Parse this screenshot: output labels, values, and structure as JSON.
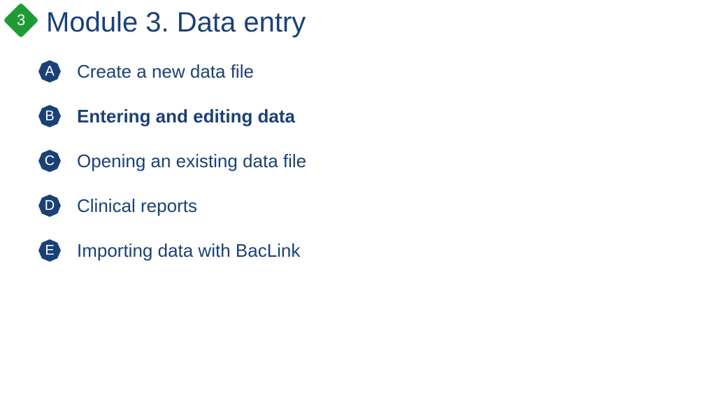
{
  "module": {
    "number": "3",
    "title": "Module 3. Data entry"
  },
  "items": [
    {
      "letter": "A",
      "label": "Create a new data file",
      "active": false
    },
    {
      "letter": "B",
      "label": "Entering and editing data",
      "active": true
    },
    {
      "letter": "C",
      "label": "Opening an existing data file",
      "active": false
    },
    {
      "letter": "D",
      "label": "Clinical reports",
      "active": false
    },
    {
      "letter": "E",
      "label": "Importing data with BacLink",
      "active": false
    }
  ],
  "colors": {
    "brand": "#1a4177",
    "accent": "#1f9b34"
  }
}
